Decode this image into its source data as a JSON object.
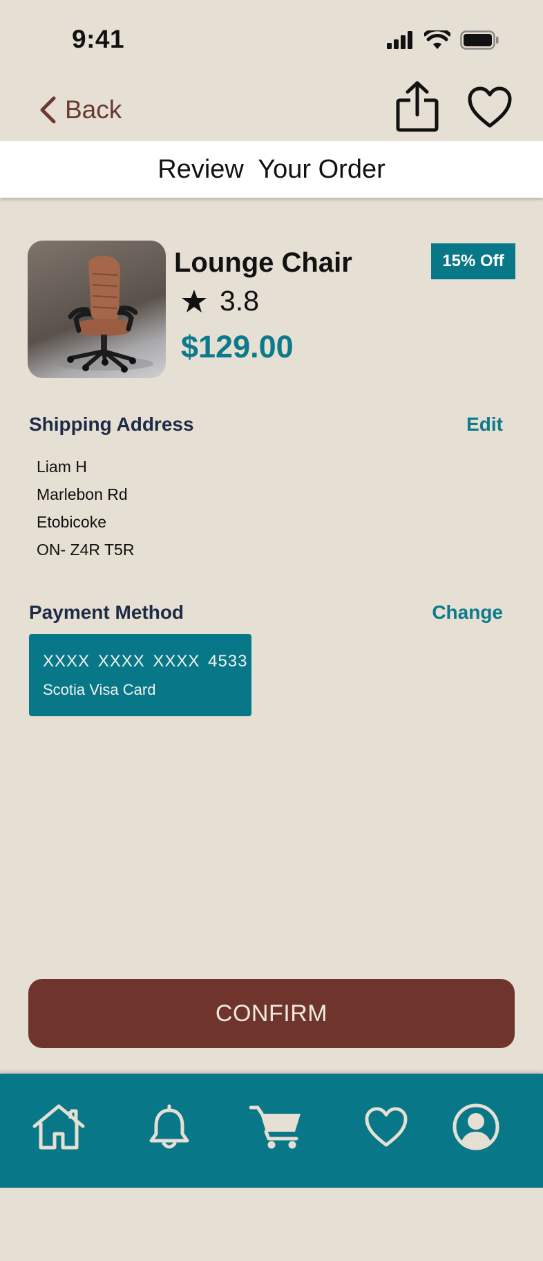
{
  "status_bar": {
    "time": "9:41",
    "icons": [
      "cellular-signal-icon",
      "wifi-icon",
      "battery-icon"
    ]
  },
  "nav": {
    "back_label": "Back",
    "icons": [
      "chevron-left-icon",
      "share-icon",
      "heart-icon"
    ]
  },
  "header": {
    "title": "Review  Your Order"
  },
  "product": {
    "name": "Lounge Chair",
    "rating": "3.8",
    "price": "$129.00",
    "discount": "15% Off",
    "image": "office-chair-photo"
  },
  "shipping": {
    "heading": "Shipping Address",
    "action": "Edit",
    "lines": [
      "Liam H",
      "Marlebon Rd",
      "Etobicoke",
      "ON- Z4R T5R"
    ]
  },
  "payment": {
    "heading": "Payment Method",
    "action": "Change",
    "card_number": "XXXX  XXXX  XXXX  4533",
    "card_name": "Scotia Visa Card"
  },
  "confirm_label": "CONFIRM",
  "tabbar": {
    "icons": [
      "home-icon",
      "bell-icon",
      "cart-icon",
      "heart-icon",
      "profile-icon"
    ]
  },
  "colors": {
    "background": "#e6dfd3",
    "accent": "#087787",
    "brand_brown": "#6f352c",
    "heading_navy": "#1d2b46"
  }
}
